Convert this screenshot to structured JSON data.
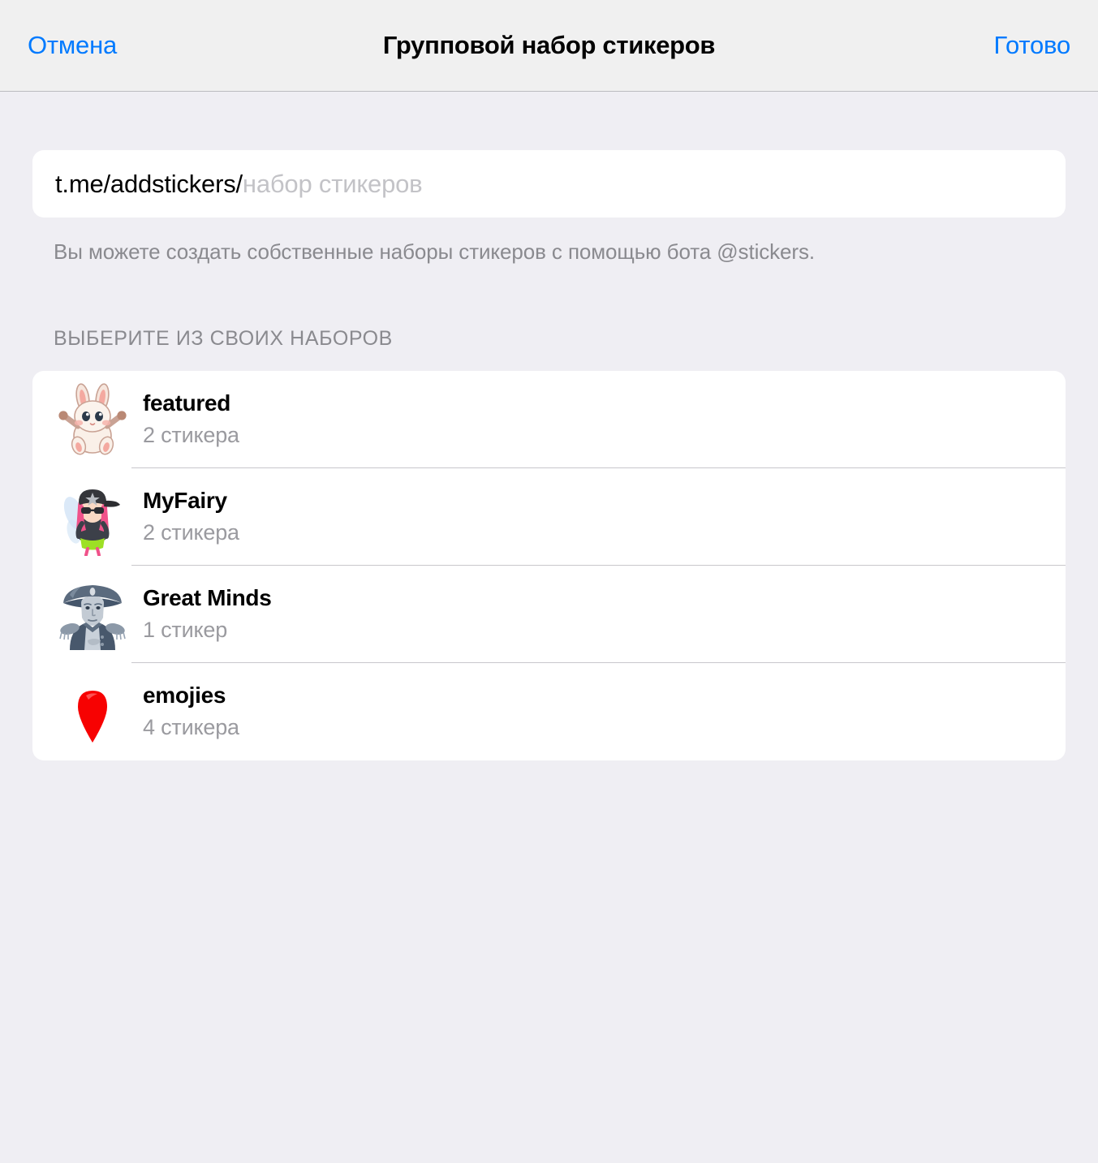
{
  "navbar": {
    "cancel_label": "Отмена",
    "title": "Групповой набор стикеров",
    "done_label": "Готово",
    "accent_color": "#007AFF"
  },
  "input": {
    "prefix": "t.me/addstickers/",
    "placeholder": "набор стикеров",
    "value": ""
  },
  "footer_note": "Вы можете создать собственные наборы стикеров с помощью бота @stickers.",
  "section": {
    "header": "ВЫБЕРИТЕ ИЗ СВОИХ НАБОРОВ"
  },
  "sticker_sets": [
    {
      "title": "featured",
      "subtitle": "2 стикера",
      "thumb_icon": "bunny-sticker-icon"
    },
    {
      "title": "MyFairy",
      "subtitle": "2 стикера",
      "thumb_icon": "fairy-girl-sticker-icon"
    },
    {
      "title": "Great Minds",
      "subtitle": "1 стикер",
      "thumb_icon": "napoleon-sticker-icon"
    },
    {
      "title": "emojies",
      "subtitle": "4 стикера",
      "thumb_icon": "red-pin-sticker-icon"
    }
  ],
  "colors": {
    "page_background": "#EFEEF3",
    "navbar_background": "#F0F0F0",
    "card_background": "#FFFFFF",
    "secondary_text": "#8A8A8F",
    "separator": "#C8C7CC"
  }
}
